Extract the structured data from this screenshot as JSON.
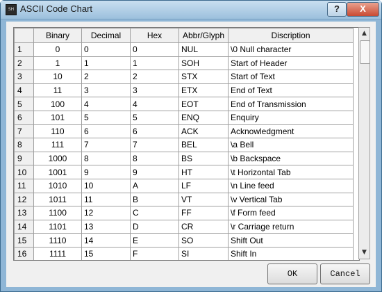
{
  "window": {
    "title": "ASCII Code Chart",
    "icon_label": "SH",
    "help_label": "?",
    "close_label": "X"
  },
  "table": {
    "headers": [
      "Binary",
      "Decimal",
      "Hex",
      "Abbr/Glyph",
      "Discription"
    ],
    "rows": [
      {
        "n": "1",
        "bin": "0",
        "dec": "0",
        "hex": "0",
        "abbr": "NUL",
        "desc": "\\0 Null character"
      },
      {
        "n": "2",
        "bin": "1",
        "dec": "1",
        "hex": "1",
        "abbr": "SOH",
        "desc": "Start of Header"
      },
      {
        "n": "3",
        "bin": "10",
        "dec": "2",
        "hex": "2",
        "abbr": "STX",
        "desc": "Start of Text"
      },
      {
        "n": "4",
        "bin": "11",
        "dec": "3",
        "hex": "3",
        "abbr": "ETX",
        "desc": "End of Text"
      },
      {
        "n": "5",
        "bin": "100",
        "dec": "4",
        "hex": "4",
        "abbr": "EOT",
        "desc": "End of Transmission"
      },
      {
        "n": "6",
        "bin": "101",
        "dec": "5",
        "hex": "5",
        "abbr": "ENQ",
        "desc": "Enquiry"
      },
      {
        "n": "7",
        "bin": "110",
        "dec": "6",
        "hex": "6",
        "abbr": "ACK",
        "desc": "Acknowledgment"
      },
      {
        "n": "8",
        "bin": "111",
        "dec": "7",
        "hex": "7",
        "abbr": "BEL",
        "desc": "\\a Bell"
      },
      {
        "n": "9",
        "bin": "1000",
        "dec": "8",
        "hex": "8",
        "abbr": "BS",
        "desc": "\\b Backspace"
      },
      {
        "n": "10",
        "bin": "1001",
        "dec": "9",
        "hex": "9",
        "abbr": "HT",
        "desc": "\\t Horizontal Tab"
      },
      {
        "n": "11",
        "bin": "1010",
        "dec": "10",
        "hex": "A",
        "abbr": "LF",
        "desc": "\\n Line feed"
      },
      {
        "n": "12",
        "bin": "1011",
        "dec": "11",
        "hex": "B",
        "abbr": "VT",
        "desc": "\\v Vertical Tab"
      },
      {
        "n": "13",
        "bin": "1100",
        "dec": "12",
        "hex": "C",
        "abbr": "FF",
        "desc": "\\f Form feed"
      },
      {
        "n": "14",
        "bin": "1101",
        "dec": "13",
        "hex": "D",
        "abbr": "CR",
        "desc": "\\r Carriage return"
      },
      {
        "n": "15",
        "bin": "1110",
        "dec": "14",
        "hex": "E",
        "abbr": "SO",
        "desc": "Shift Out"
      },
      {
        "n": "16",
        "bin": "1111",
        "dec": "15",
        "hex": "F",
        "abbr": "SI",
        "desc": "Shift In"
      }
    ]
  },
  "buttons": {
    "ok": "OK",
    "cancel": "Cancel"
  },
  "scrollbar": {
    "up_icon": "triangle-up",
    "down_icon": "triangle-down"
  }
}
